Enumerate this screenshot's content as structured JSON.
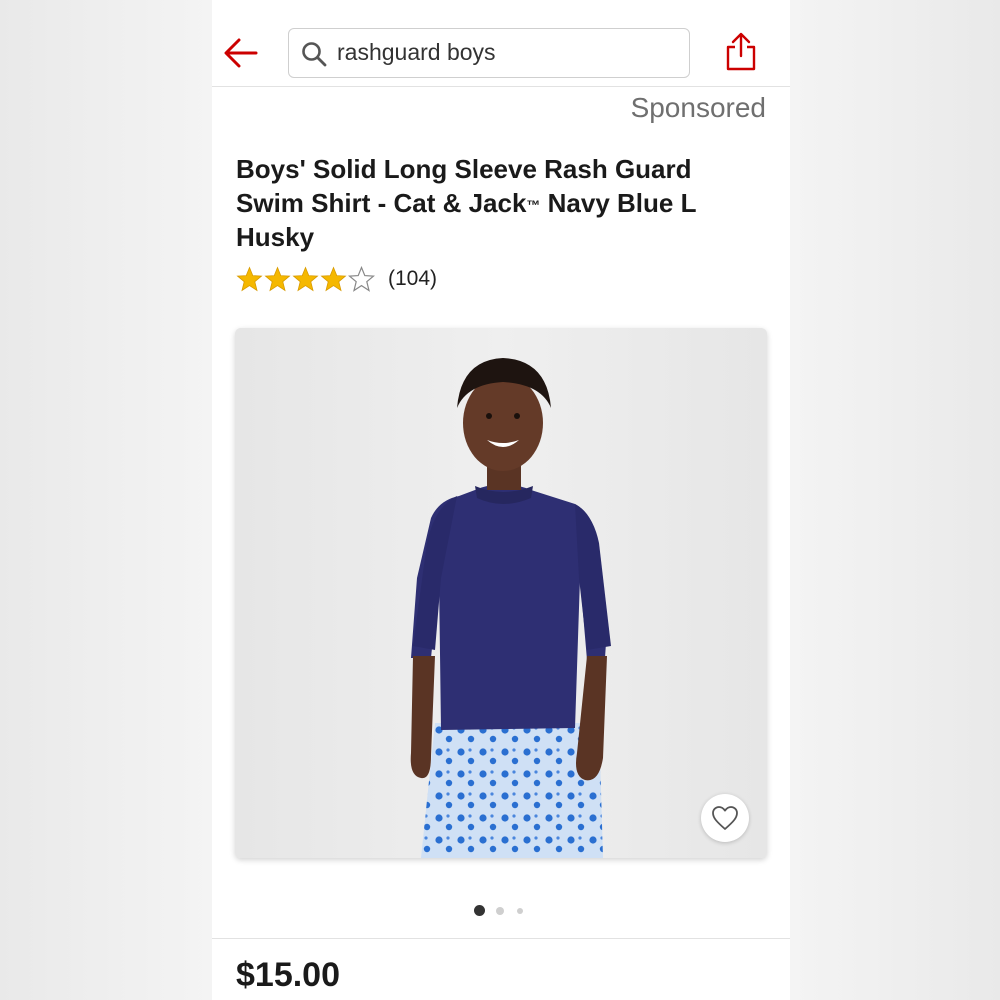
{
  "header": {
    "search": {
      "value": "rashguard boys",
      "icon": "search-icon"
    },
    "back_icon": "arrow-left-icon",
    "share_icon": "share-icon",
    "accent_color": "#cc0000"
  },
  "product": {
    "sponsored_label": "Sponsored",
    "title_main": "Boys' Solid Long Sleeve Rash Guard Swim Shirt - Cat & Jack",
    "title_tm": "™",
    "title_rest": " Navy Blue L Husky",
    "rating": {
      "value": 4,
      "max": 5,
      "review_count": "(104)",
      "star_color": "#f5b800"
    },
    "image": {
      "favorite_icon": "heart-outline-icon",
      "carousel_pages": 3,
      "carousel_active": 1
    },
    "price": "$15.00"
  }
}
